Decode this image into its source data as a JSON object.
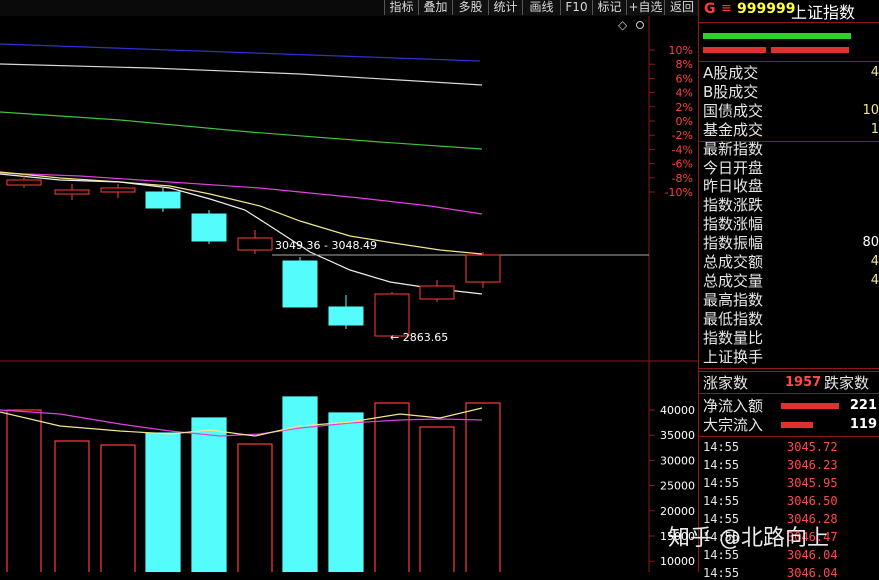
{
  "toolbar": {
    "buttons": [
      "指标",
      "叠加",
      "多股",
      "统计",
      "画线",
      "F10",
      "标记",
      "+自选",
      "返回"
    ]
  },
  "stock": {
    "market": "G",
    "eq_icon": "≡",
    "code": "999999",
    "name": "上证指数"
  },
  "pct_axis": [
    "10%",
    "8%",
    "6%",
    "4%",
    "2%",
    "0%",
    "-2%",
    "-4%",
    "-6%",
    "-8%",
    "-10%"
  ],
  "vol_axis": [
    "40000",
    "35000",
    "30000",
    "25000",
    "20000",
    "15000",
    "10000"
  ],
  "annotations": {
    "crosshair_price": "3049.36 - 3048.49",
    "low_price": "2863.65"
  },
  "info_labels": [
    "A股成交",
    "B股成交",
    "国债成交",
    "基金成交",
    "最新指数",
    "今日开盘",
    "昨日收盘",
    "指数涨跌",
    "指数涨幅",
    "指数振幅",
    "总成交额",
    "总成交量",
    "最高指数",
    "最低指数",
    "指数量比",
    "上证换手"
  ],
  "info_values_partial": {
    "A股成交": "4",
    "国债成交": "10",
    "基金成交": "1",
    "指数振幅": "80",
    "总成交额": "4",
    "总成交量": "4"
  },
  "breadth": {
    "up_label": "涨家数",
    "up_value": "1957",
    "down_label": "跌家数"
  },
  "flows": [
    {
      "label": "净流入额",
      "value": "221"
    },
    {
      "label": "大宗流入",
      "value": "119"
    }
  ],
  "ticks": [
    {
      "time": "14:55",
      "price": "3045.72"
    },
    {
      "time": "14:55",
      "price": "3046.23"
    },
    {
      "time": "14:55",
      "price": "3045.95"
    },
    {
      "time": "14:55",
      "price": "3046.50"
    },
    {
      "time": "14:55",
      "price": "3046.28"
    },
    {
      "time": "14:55",
      "price": "3046.47"
    },
    {
      "time": "14:55",
      "price": "3046.04"
    },
    {
      "time": "14:55",
      "price": "3046.04"
    }
  ],
  "watermark": "知乎 @北路向上",
  "colors": {
    "up": "#ff3b3b",
    "down": "#54fcfc",
    "ma_white": "#ffffff",
    "ma_yellow": "#f0e68c",
    "ma_magenta": "#e040e0",
    "ma_green": "#40c040",
    "ma_blue": "#3030d0",
    "grid": "#7a1010"
  }
}
